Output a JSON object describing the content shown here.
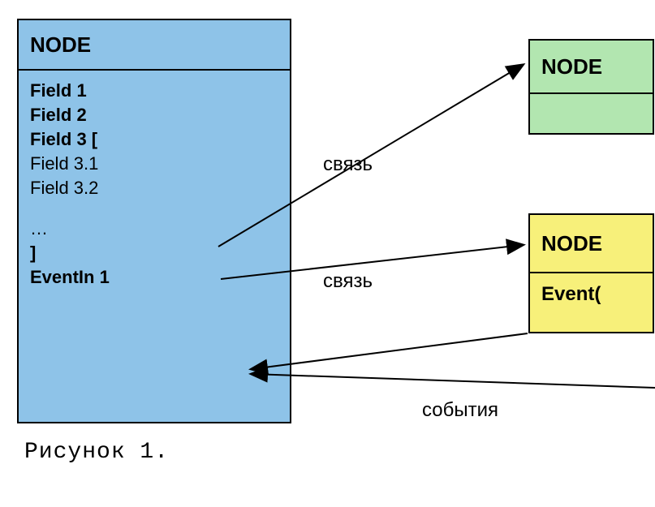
{
  "nodes": {
    "main": {
      "title": "NODE",
      "fields": {
        "f1": "Field 1",
        "f2": "Field 2",
        "f3open": "Field 3 [",
        "f31": "Field 3.1",
        "f32": "Field 3.2",
        "ellipsis": "…",
        "close": "]",
        "eventIn": "EventIn 1"
      }
    },
    "green": {
      "title": "NODE"
    },
    "yellow": {
      "title": "NODE",
      "eventOut": "Event("
    }
  },
  "labels": {
    "link1": "связь",
    "link2": "связь",
    "events": "события"
  },
  "caption": "Рисунок 1."
}
